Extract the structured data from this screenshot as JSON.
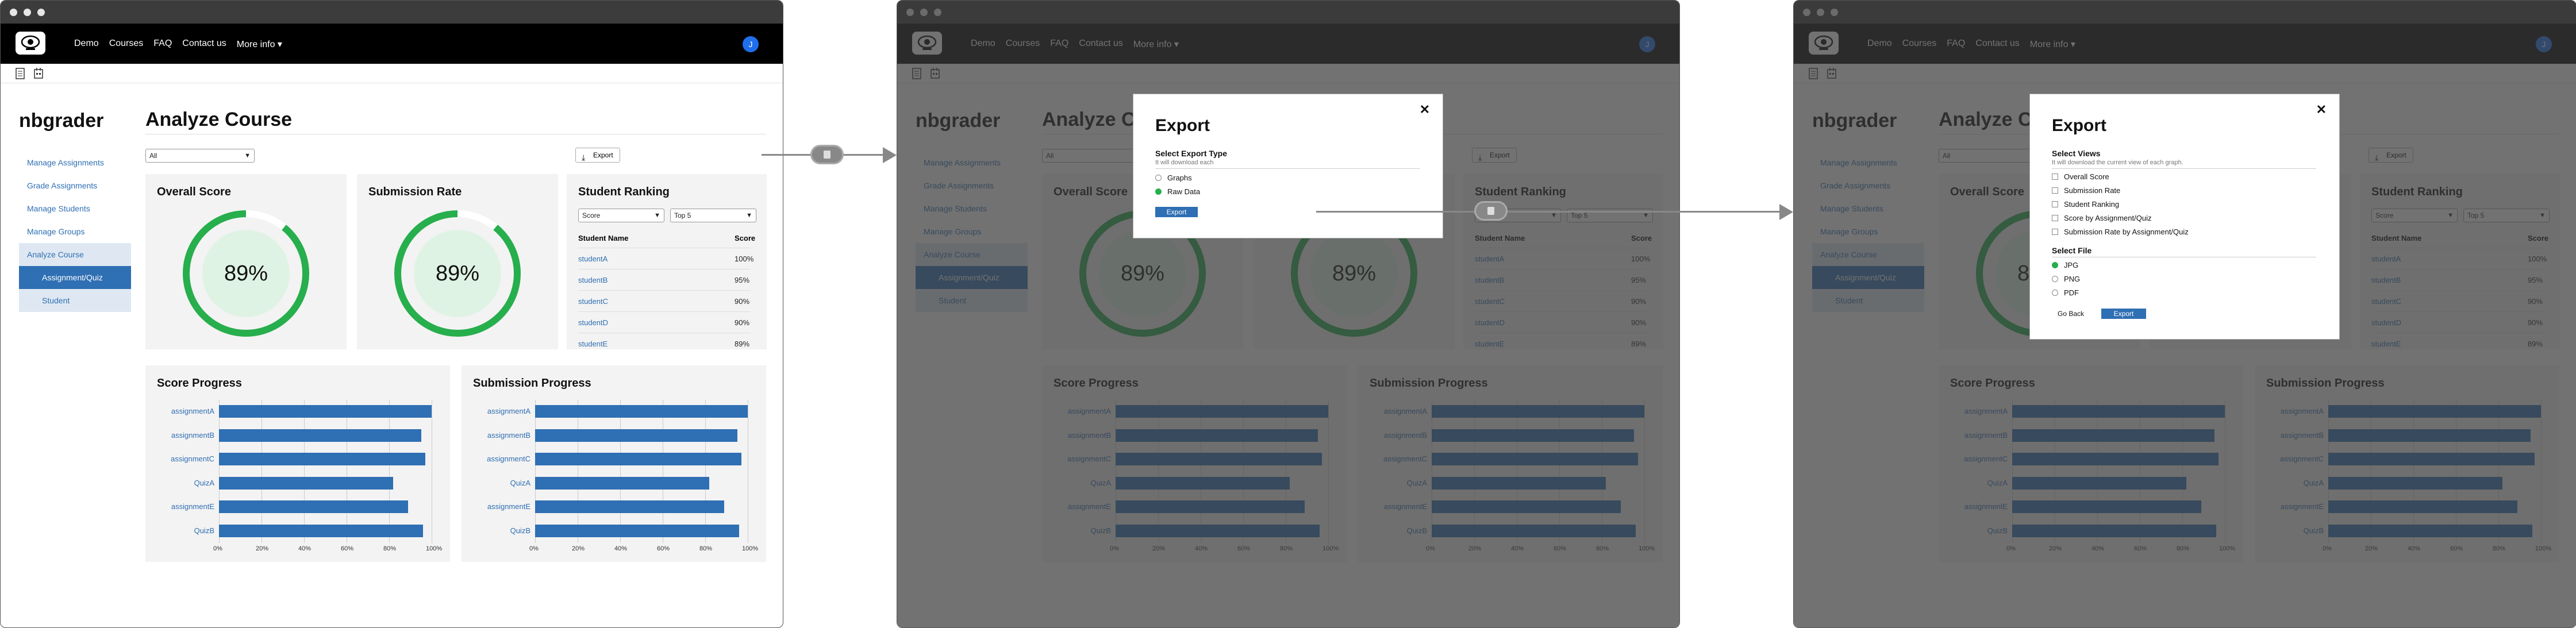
{
  "nav": {
    "links": [
      "Demo",
      "Courses",
      "FAQ",
      "Contact us",
      "More info"
    ],
    "more_chevron": "chevron-down-icon",
    "user_initial": "J"
  },
  "app": {
    "brand": "nbgrader",
    "page_title": "Analyze Course"
  },
  "sidebar": {
    "items": [
      {
        "label": "Manage Assignments"
      },
      {
        "label": "Grade Assignments"
      },
      {
        "label": "Manage Students"
      },
      {
        "label": "Manage Groups"
      },
      {
        "label": "Analyze Course"
      },
      {
        "label": "Assignment/Quiz"
      },
      {
        "label": "Student"
      }
    ]
  },
  "filters": {
    "scope": "All",
    "rank_metric": "Score",
    "rank_limit": "Top 5"
  },
  "export_button": "Export",
  "overall": {
    "title": "Overall Score",
    "value_text": "89%",
    "fraction": 0.89
  },
  "submission": {
    "title": "Submission Rate",
    "value_text": "89%",
    "fraction": 0.89
  },
  "ranking": {
    "title": "Student Ranking",
    "col_name": "Student Name",
    "col_score": "Score",
    "rows": [
      {
        "name": "studentA",
        "score": "100%"
      },
      {
        "name": "studentB",
        "score": "95%"
      },
      {
        "name": "studentC",
        "score": "90%"
      },
      {
        "name": "studentD",
        "score": "90%"
      },
      {
        "name": "studentE",
        "score": "89%"
      }
    ]
  },
  "chart_data": [
    {
      "type": "bar",
      "title": "Score Progress",
      "orientation": "horizontal",
      "categories": [
        "assignmentA",
        "assignmentB",
        "assignmentC",
        "QuizA",
        "assignmentE",
        "QuizB"
      ],
      "values": [
        100,
        95,
        97,
        82,
        89,
        96
      ],
      "xlim": [
        0,
        100
      ],
      "ticks": [
        "0%",
        "20%",
        "40%",
        "60%",
        "80%",
        "100%"
      ],
      "color": "#2f6fb3"
    },
    {
      "type": "bar",
      "title": "Submission Progress",
      "orientation": "horizontal",
      "categories": [
        "assignmentA",
        "assignmentB",
        "assignmentC",
        "QuizA",
        "assignmentE",
        "QuizB"
      ],
      "values": [
        100,
        95,
        97,
        82,
        89,
        96
      ],
      "xlim": [
        0,
        100
      ],
      "ticks": [
        "0%",
        "20%",
        "40%",
        "60%",
        "80%",
        "100%"
      ],
      "color": "#2f6fb3"
    }
  ],
  "modal1": {
    "title": "Export",
    "heading": "Select Export Type",
    "note": "It will download each",
    "options": [
      {
        "label": "Graphs",
        "selected": false
      },
      {
        "label": "Raw Data",
        "selected": true
      }
    ],
    "button": "Export"
  },
  "modal2": {
    "title": "Export",
    "views_heading": "Select Views",
    "views_note": "It will download the current view of each graph.",
    "views": [
      "Overall Score",
      "Submission Rate",
      "Student Ranking",
      "Score by Assignment/Quiz",
      "Submission Rate by Assignment/Quiz"
    ],
    "file_heading": "Select File",
    "files": [
      {
        "label": "JPG",
        "selected": true
      },
      {
        "label": "PNG",
        "selected": false
      },
      {
        "label": "PDF",
        "selected": false
      }
    ],
    "back_button": "Go Back",
    "export_button": "Export"
  },
  "colors": {
    "accent": "#2f6fb3",
    "ring": "#27ae4d",
    "ring_bg": "#dff3e4",
    "nav": "#000000"
  }
}
